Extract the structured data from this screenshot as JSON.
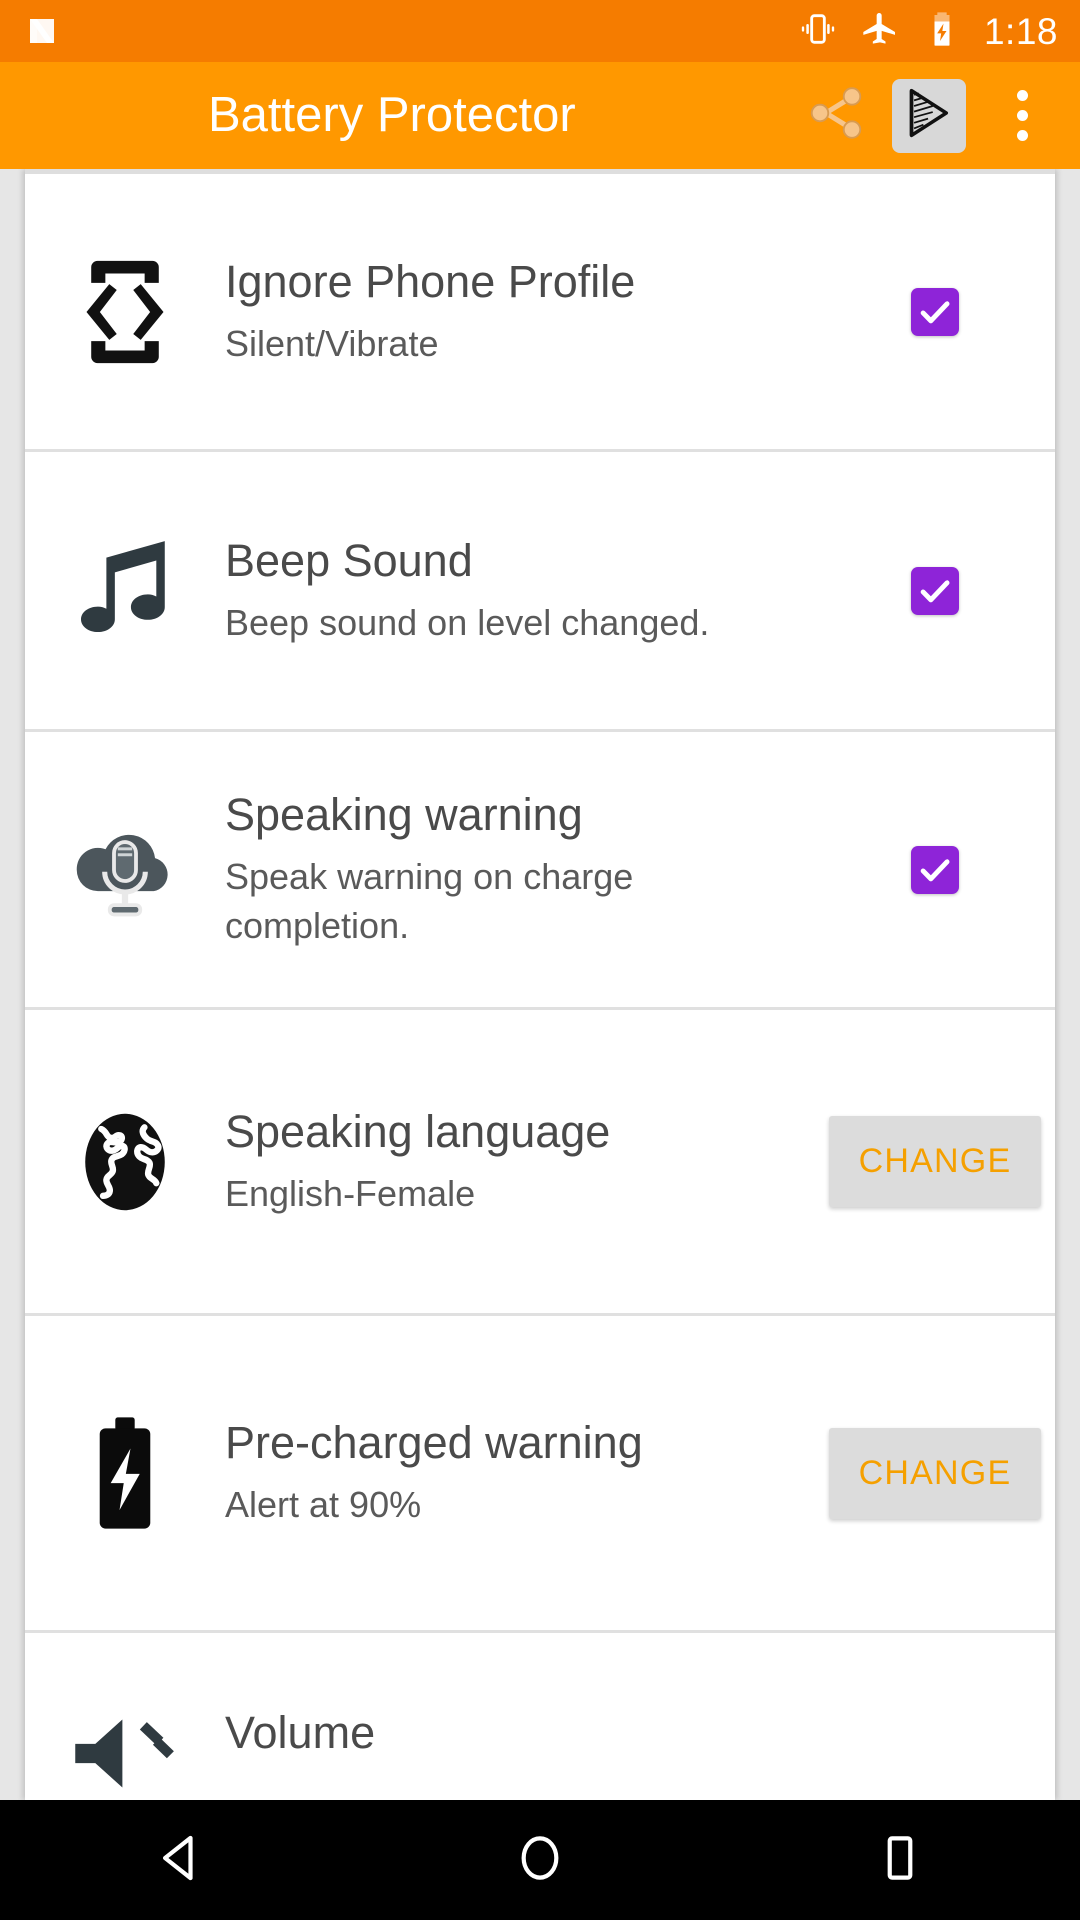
{
  "status_bar": {
    "logo": "android-n-logo",
    "icons": [
      "vibrate-icon",
      "airplane-mode-icon",
      "battery-charging-icon"
    ],
    "time": "1:18",
    "background": "#F57C00"
  },
  "app_bar": {
    "title": "Battery Protector",
    "background": "#FF9800",
    "title_color": "#FFFFFF",
    "actions": [
      {
        "name": "share-icon",
        "label": "Share"
      },
      {
        "name": "play-store-icon",
        "label": "Rate on Play Store"
      },
      {
        "name": "overflow-menu-icon",
        "label": "More options"
      }
    ]
  },
  "settings": {
    "accent_checkbox": "#8E24D8",
    "button_bg": "#DCDCDC",
    "button_text_color": "#F5A000",
    "items": [
      {
        "icon": "phone-vibrate-icon",
        "title": "Ignore Phone Profile",
        "subtitle": "Silent/Vibrate",
        "control": "checkbox",
        "checked": true
      },
      {
        "icon": "music-note-icon",
        "title": "Beep Sound",
        "subtitle": "Beep sound on level changed.",
        "control": "checkbox",
        "checked": true
      },
      {
        "icon": "cloud-microphone-icon",
        "title": "Speaking warning",
        "subtitle": "Speak warning on charge completion.",
        "control": "checkbox",
        "checked": true
      },
      {
        "icon": "globe-icon",
        "title": "Speaking language",
        "subtitle": "English-Female",
        "control": "button",
        "button_label": "CHANGE"
      },
      {
        "icon": "battery-bolt-icon",
        "title": "Pre-charged warning",
        "subtitle": "Alert at 90%",
        "control": "button",
        "button_label": "CHANGE"
      },
      {
        "icon": "volume-icon",
        "title": "Volume",
        "subtitle": "",
        "control": "none"
      }
    ]
  },
  "nav_bar": {
    "background": "#000000",
    "buttons": [
      {
        "name": "back-button",
        "label": "Back"
      },
      {
        "name": "home-button",
        "label": "Home"
      },
      {
        "name": "recents-button",
        "label": "Recents"
      }
    ]
  }
}
